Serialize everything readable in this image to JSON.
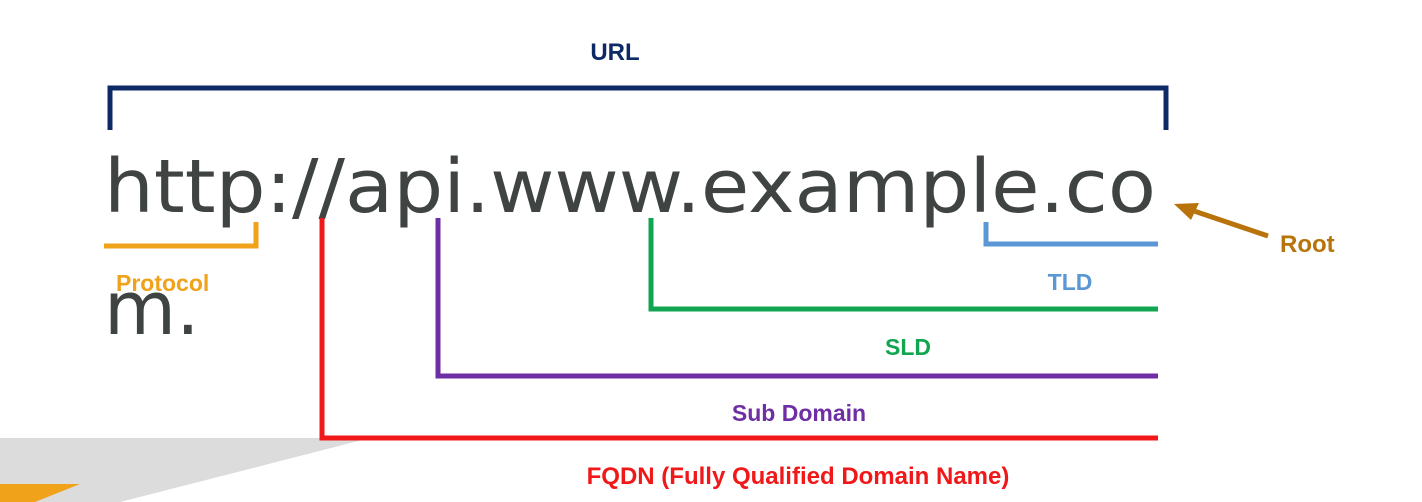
{
  "url_line1": "http://api.www.example.co",
  "url_line2": "m.",
  "labels": {
    "url": "URL",
    "protocol": "Protocol",
    "tld": "TLD",
    "sld": "SLD",
    "subdomain": "Sub Domain",
    "fqdn": "FQDN (Fully Qualified Domain Name)",
    "root": "Root"
  },
  "colors": {
    "url": "#0d2a66",
    "protocol": "#f0a21a",
    "tld": "#5b97d5",
    "sld": "#12a551",
    "subdomain": "#6d2fa3",
    "fqdn": "#f01818",
    "root": "#b8730a",
    "text": "#3f4443"
  }
}
